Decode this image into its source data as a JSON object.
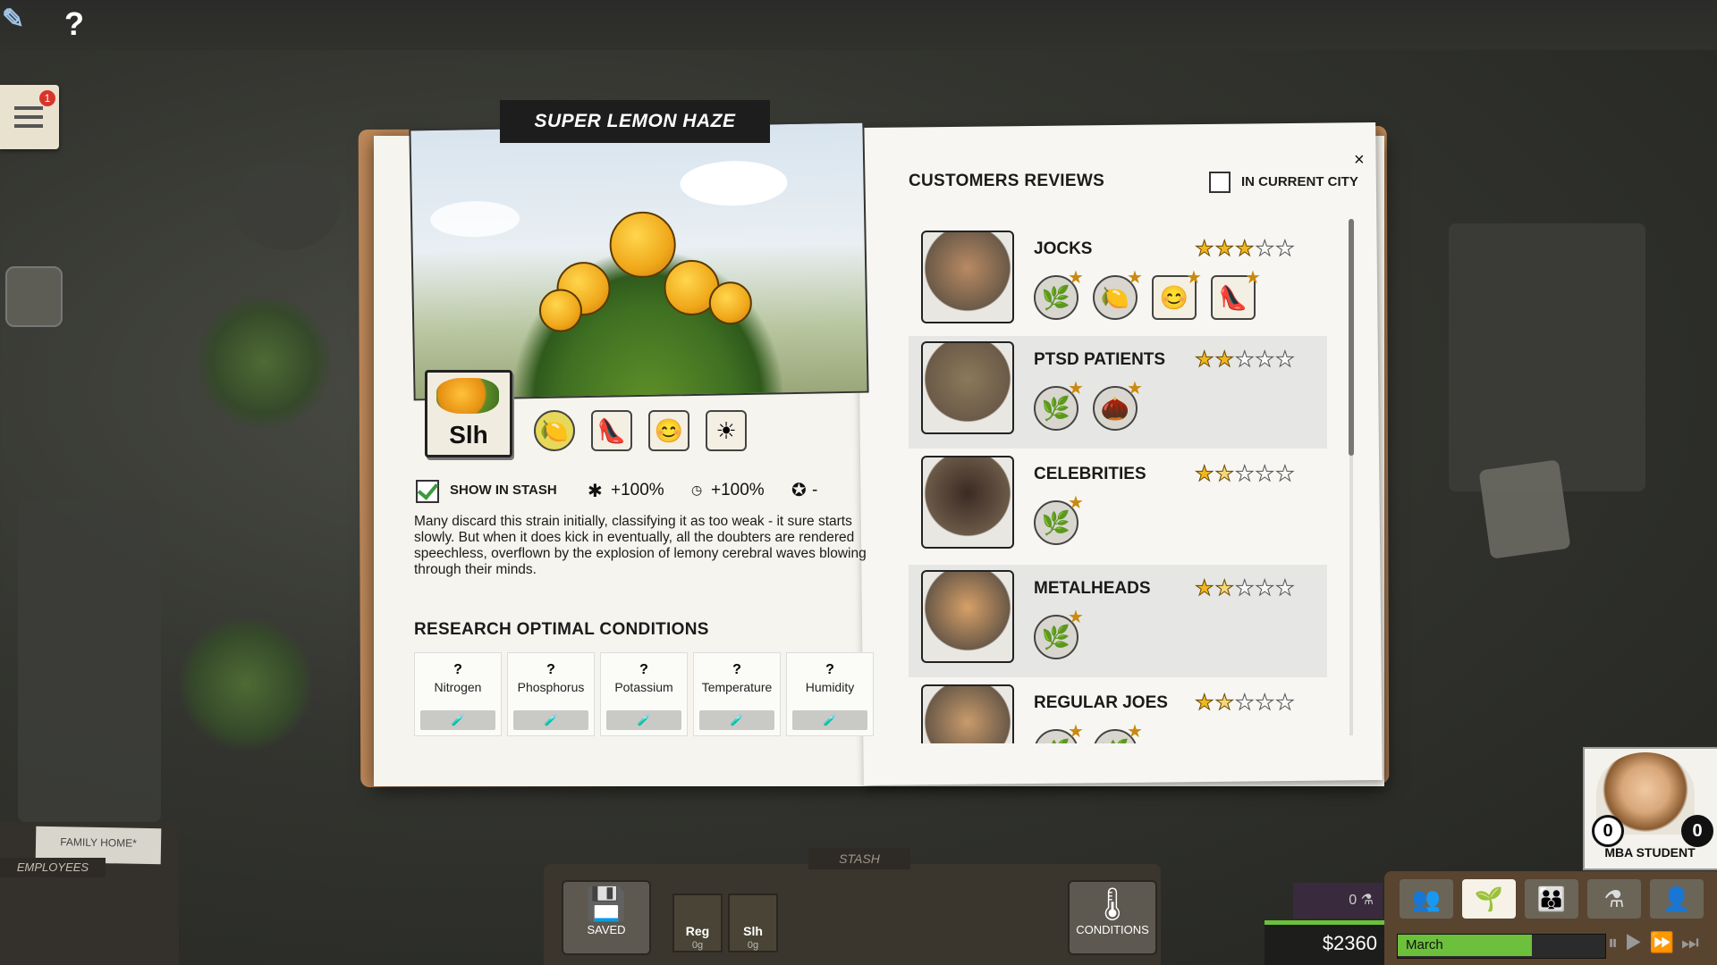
{
  "hud": {
    "help_icon": "?",
    "notification_count": "1"
  },
  "strain": {
    "title": "SUPER LEMON HAZE",
    "abbr": "Slh",
    "show_in_stash_label": "SHOW IN STASH",
    "show_in_stash_checked": true,
    "potency_stat": "+100%",
    "speed_stat": "+100%",
    "award_stat": "-",
    "effect_icons": [
      "lemon-icon",
      "high-heel-icon",
      "smiley-icon",
      "sun-icon"
    ],
    "description": "Many discard this strain initially, classifying it as too weak - it sure starts slowly. But when it does kick in eventually, all the doubters are rendered speechless, overflown by the explosion of lemony cerebral waves blowing through their minds."
  },
  "research": {
    "title": "RESEARCH OPTIMAL CONDITIONS",
    "conditions": [
      {
        "value": "?",
        "name": "Nitrogen"
      },
      {
        "value": "?",
        "name": "Phosphorus"
      },
      {
        "value": "?",
        "name": "Potassium"
      },
      {
        "value": "?",
        "name": "Temperature"
      },
      {
        "value": "?",
        "name": "Humidity"
      }
    ]
  },
  "reviews": {
    "title": "CUSTOMERS REVIEWS",
    "city_filter_label": "IN CURRENT CITY",
    "city_filter_checked": false,
    "close_label": "×",
    "groups": [
      {
        "name": "JOCKS",
        "rating": 3.0,
        "prefs": [
          "weed-icon",
          "lemon-icon",
          "smiley-icon",
          "high-heel-icon"
        ]
      },
      {
        "name": "PTSD PATIENTS",
        "rating": 2.0,
        "prefs": [
          "weed-icon",
          "nut-icon"
        ]
      },
      {
        "name": "CELEBRITIES",
        "rating": 1.5,
        "prefs": [
          "weed-icon"
        ]
      },
      {
        "name": "METALHEADS",
        "rating": 1.5,
        "prefs": [
          "weed-icon"
        ]
      },
      {
        "name": "REGULAR JOES",
        "rating": 1.5,
        "prefs": [
          "weed-icon",
          "weed-icon"
        ]
      }
    ]
  },
  "bottom": {
    "stash_label": "STASH",
    "saved_label": "SAVED",
    "conditions_label": "CONDITIONS",
    "stash_items": [
      {
        "abbr": "Reg",
        "qty": "0g"
      },
      {
        "abbr": "Slh",
        "qty": "0g"
      }
    ],
    "employees_label": "EMPLOYEES",
    "family_home_label": "FAMILY HOME*"
  },
  "player": {
    "name": "MBA STUDENT",
    "left_count": "0",
    "right_count": "0",
    "money": "$2360",
    "month": "March",
    "month_progress": 0.65,
    "lab_count": "0"
  },
  "colors": {
    "accent_green": "#6cc03c",
    "star_gold": "#f0b71f",
    "title_bg": "#1d1d1d"
  }
}
